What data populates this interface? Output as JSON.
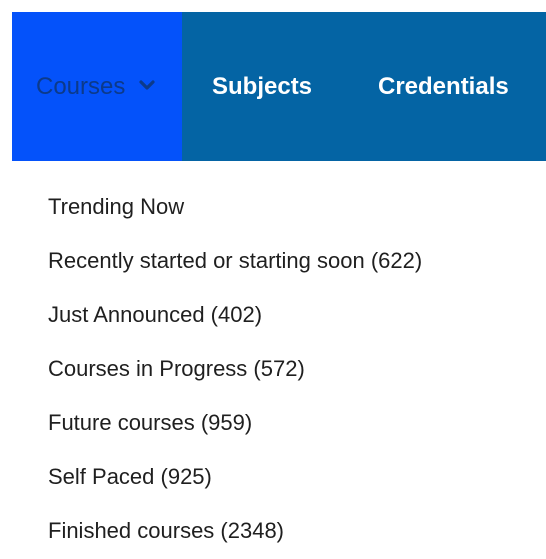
{
  "navbar": {
    "items": [
      {
        "label": "Courses",
        "active": true,
        "icon": "chevron-down-icon"
      },
      {
        "label": "Subjects",
        "active": false
      },
      {
        "label": "Credentials",
        "active": false
      }
    ],
    "colors": {
      "bar": "#0464a4",
      "active": "#0452fa",
      "active_text": "#0c3a8a"
    }
  },
  "dropdown": {
    "items": [
      {
        "label": "Trending Now"
      },
      {
        "label": "Recently started or starting soon (622)"
      },
      {
        "label": "Just Announced (402)"
      },
      {
        "label": "Courses in Progress (572)"
      },
      {
        "label": "Future courses (959)"
      },
      {
        "label": "Self Paced (925)"
      },
      {
        "label": "Finished courses (2348)"
      }
    ]
  }
}
